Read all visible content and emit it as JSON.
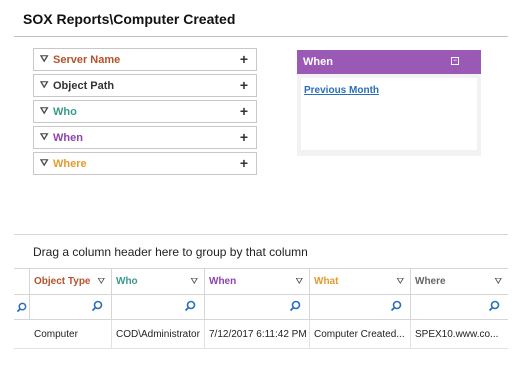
{
  "page": {
    "title": "SOX Reports\\Computer Created"
  },
  "filters": [
    {
      "label": "Server Name",
      "color": "#b5532a"
    },
    {
      "label": "Object Path",
      "color": "#333333"
    },
    {
      "label": "Who",
      "color": "#3a9a8c"
    },
    {
      "label": "When",
      "color": "#8e44ad"
    },
    {
      "label": "Where",
      "color": "#e59a2f"
    }
  ],
  "when_panel": {
    "title": "When",
    "link": "Previous Month",
    "accent": "#9b59b6"
  },
  "grid": {
    "group_hint": "Drag a column header here to group by that column",
    "columns": [
      {
        "label": "Object Type",
        "color": "#b5532a"
      },
      {
        "label": "Who",
        "color": "#3a9a8c"
      },
      {
        "label": "When",
        "color": "#8e44ad"
      },
      {
        "label": "What",
        "color": "#e59a2f"
      },
      {
        "label": "Where",
        "color": "#666666"
      }
    ],
    "rows": [
      [
        "Computer",
        "COD\\Administrator",
        "7/12/2017 6:11:42 PM",
        "Computer Created...",
        "SPEX10.www.co..."
      ]
    ]
  }
}
